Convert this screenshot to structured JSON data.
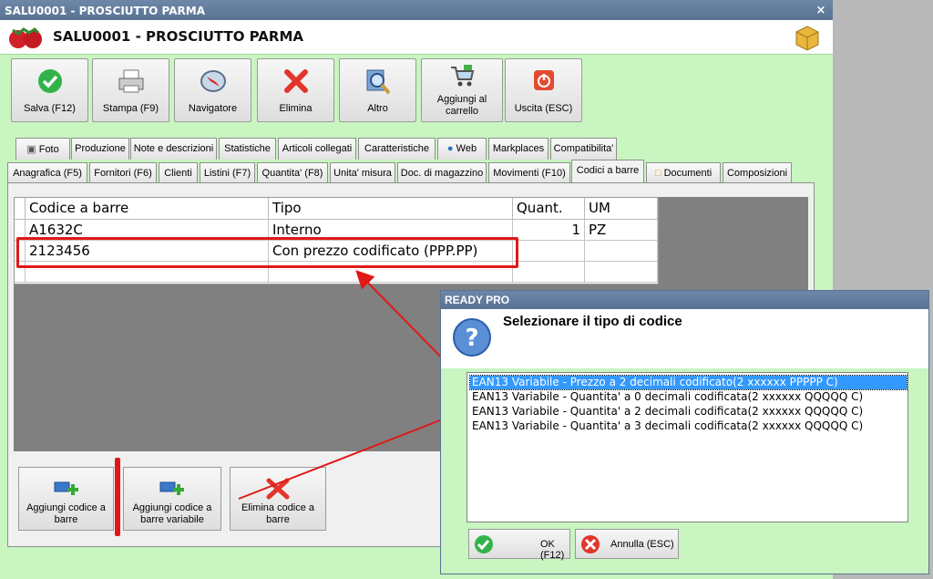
{
  "window": {
    "title": "SALU0001 - PROSCIUTTO PARMA",
    "header_title": "SALU0001 - PROSCIUTTO PARMA",
    "close": "×"
  },
  "toolbar": {
    "save": "Salva (F12)",
    "print": "Stampa (F9)",
    "navigator": "Navigatore",
    "delete": "Elimina",
    "other": "Altro",
    "add_cart_1": "Aggiungi al",
    "add_cart_2": "carrello",
    "exit": "Uscita (ESC)"
  },
  "tabs_row1": [
    "Foto",
    "Produzione",
    "Note e descrizioni",
    "Statistiche",
    "Articoli collegati",
    "Caratteristiche",
    "Web",
    "Markplaces",
    "Compatibilita'"
  ],
  "tabs_row2": [
    "Anagrafica (F5)",
    "Fornitori (F6)",
    "Clienti",
    "Listini (F7)",
    "Quantita' (F8)",
    "Unita' misura",
    "Doc. di magazzino",
    "Movimenti (F10)",
    "Codici a barre",
    "Documenti",
    "Composizioni"
  ],
  "grid": {
    "headers": [
      "Codice a barre",
      "Tipo",
      "Quant.",
      "UM"
    ],
    "rows": [
      {
        "code": "A1632C",
        "type": "Interno",
        "qty": "1",
        "um": "PZ"
      },
      {
        "code": "2123456",
        "type": "Con prezzo codificato (PPP.PP)",
        "qty": "",
        "um": ""
      }
    ]
  },
  "bottom": {
    "add_1": "Aggiungi codice a",
    "add_2": "barre",
    "addvar_1": "Aggiungi codice a",
    "addvar_2": "barre variabile",
    "del_1": "Elimina codice a",
    "del_2": "barre"
  },
  "dialog": {
    "title": "READY PRO",
    "question": "Selezionare il tipo di codice",
    "options": [
      "EAN13 Variabile - Prezzo a 2 decimali codificato(2 xxxxxx PPPPP C)",
      "EAN13 Variabile - Quantita' a 0 decimali codificata(2 xxxxxx QQQQQ C)",
      "EAN13 Variabile - Quantita' a 2 decimali codificata(2 xxxxxx QQQQQ C)",
      "EAN13 Variabile - Quantita' a 3 decimali codificata(2 xxxxxx QQQQQ C)"
    ],
    "selected_index": 0,
    "ok": "OK (F12)",
    "cancel": "Annulla (ESC)"
  },
  "colors": {
    "accent_red": "#e01818",
    "background_green": "#c8f5c0",
    "selection_blue": "#3399ff"
  }
}
